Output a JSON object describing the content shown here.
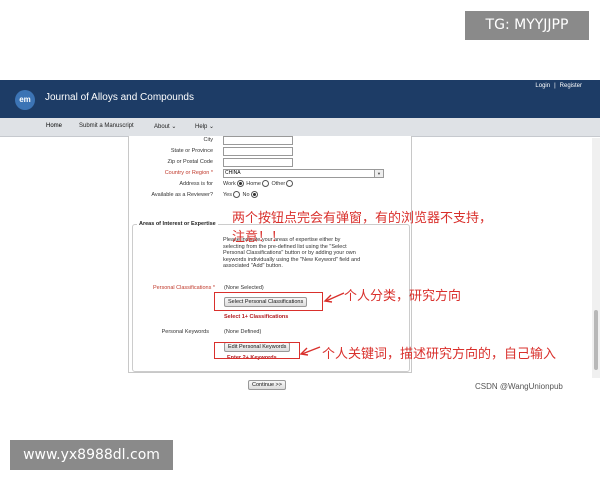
{
  "watermarks": {
    "top": "TG: MYYJJPP",
    "bottom": "www.yx8988dl.com",
    "csdn": "CSDN @WangUnionpub"
  },
  "header": {
    "logo": "em",
    "journal": "Journal of Alloys and Compounds",
    "login": "Login",
    "separator": "|",
    "register": "Register"
  },
  "nav": {
    "items": [
      "Home",
      "Submit a Manuscript",
      "About",
      "Help"
    ]
  },
  "address": {
    "city_label": "City",
    "state_label": "State or Province",
    "zip_label": "Zip or Postal Code",
    "country_label": "Country or Region",
    "country_value": "CHINA",
    "req_marker": "*",
    "address_is_for_label": "Address is for",
    "address_options": [
      "Work",
      "Home",
      "Other"
    ],
    "reviewer_label": "Available as a Reviewer?",
    "reviewer_options": [
      "Yes",
      "No"
    ]
  },
  "areas": {
    "title": "Areas of Interest or Expertise",
    "description": "Please indicate your areas of expertise either by selecting from the pre-defined list using the \"Select Personal Classifications\" button or by adding your own keywords individually using the \"New Keyword\" field and associated \"Add\" button.",
    "classifications_label": "Personal Classifications",
    "classifications_value": "(None Selected)",
    "classifications_button": "Select Personal Classifications",
    "classifications_hint": "Select 1+ Classifications",
    "keywords_label": "Personal Keywords",
    "keywords_value": "(None Defined)",
    "keywords_button": "Edit Personal Keywords",
    "keywords_hint": "Enter 2+ Keywords"
  },
  "continue_button": "Continue >>",
  "annotations": {
    "note_line1": "两个按钮点完会有弹窗，有的浏览器不支持，",
    "note_line2": "注意！！",
    "classifications_note": "个人分类，研究方向",
    "keywords_note": "个人关键词，描述研究方向的，自己输入"
  },
  "colors": {
    "header_bg": "#1d3c66",
    "nav_bg": "#dfe2e6",
    "annotation_red": "#d9302c",
    "hint_red": "#b3191d"
  }
}
